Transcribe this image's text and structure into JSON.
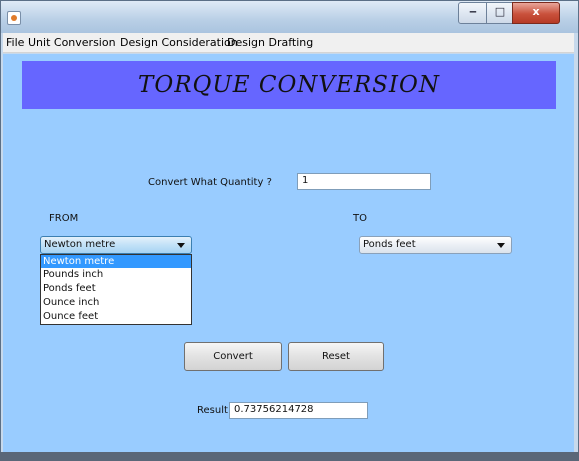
{
  "window": {
    "icon": "java-app-icon",
    "controls": {
      "minimize": "‒",
      "maximize": "□",
      "close": "x"
    }
  },
  "menubar": {
    "items": [
      "File",
      "Unit Conversion",
      "Design Consideration",
      "Design Drafting"
    ]
  },
  "banner": {
    "title": "TORQUE CONVERSION"
  },
  "form": {
    "quantity_label": "Convert What Quantity ?",
    "quantity_value": "1",
    "from_label": "FROM",
    "to_label": "TO",
    "from_selected": "Newton metre",
    "to_selected": "Ponds feet",
    "from_options": [
      "Newton metre",
      "Pounds inch",
      "Ponds feet",
      "Ounce inch",
      "Ounce feet"
    ],
    "from_options_highlighted": "Newton metre"
  },
  "buttons": {
    "convert": "Convert",
    "reset": "Reset"
  },
  "result": {
    "label": "Result",
    "value": "0.73756214728"
  },
  "colors": {
    "content_bg": "#99ccff",
    "banner_bg": "#6666ff",
    "selection": "#3399ff"
  }
}
